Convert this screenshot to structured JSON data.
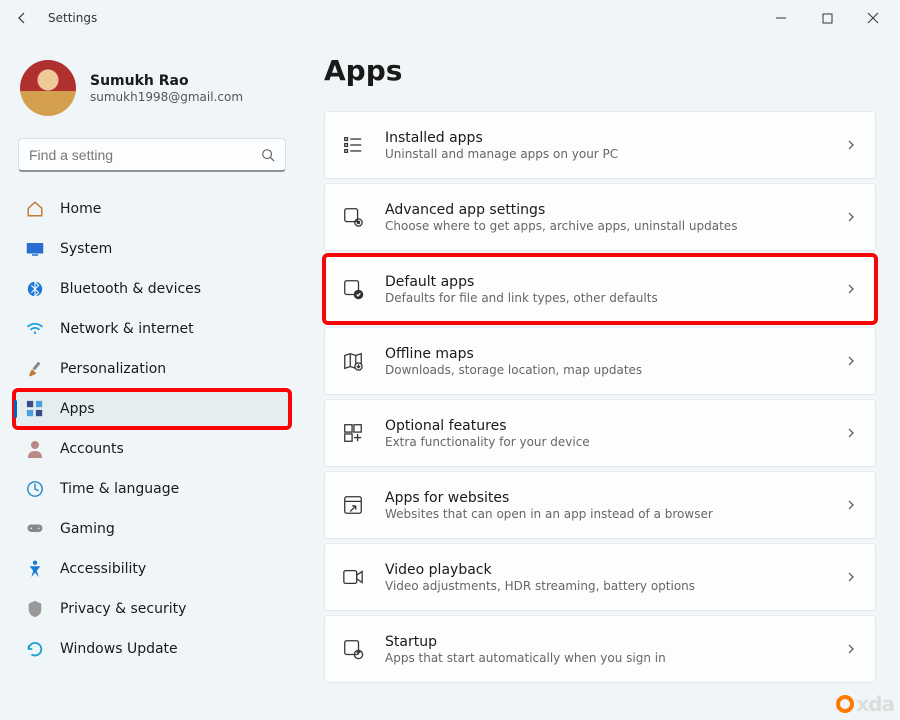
{
  "window": {
    "title": "Settings"
  },
  "profile": {
    "name": "Sumukh Rao",
    "email": "sumukh1998@gmail.com"
  },
  "search": {
    "placeholder": "Find a setting"
  },
  "nav": {
    "items": [
      {
        "label": "Home"
      },
      {
        "label": "System"
      },
      {
        "label": "Bluetooth & devices"
      },
      {
        "label": "Network & internet"
      },
      {
        "label": "Personalization"
      },
      {
        "label": "Apps"
      },
      {
        "label": "Accounts"
      },
      {
        "label": "Time & language"
      },
      {
        "label": "Gaming"
      },
      {
        "label": "Accessibility"
      },
      {
        "label": "Privacy & security"
      },
      {
        "label": "Windows Update"
      }
    ]
  },
  "page": {
    "title": "Apps"
  },
  "cards": [
    {
      "title": "Installed apps",
      "sub": "Uninstall and manage apps on your PC"
    },
    {
      "title": "Advanced app settings",
      "sub": "Choose where to get apps, archive apps, uninstall updates"
    },
    {
      "title": "Default apps",
      "sub": "Defaults for file and link types, other defaults"
    },
    {
      "title": "Offline maps",
      "sub": "Downloads, storage location, map updates"
    },
    {
      "title": "Optional features",
      "sub": "Extra functionality for your device"
    },
    {
      "title": "Apps for websites",
      "sub": "Websites that can open in an app instead of a browser"
    },
    {
      "title": "Video playback",
      "sub": "Video adjustments, HDR streaming, battery options"
    },
    {
      "title": "Startup",
      "sub": "Apps that start automatically when you sign in"
    }
  ],
  "watermark": "xda"
}
